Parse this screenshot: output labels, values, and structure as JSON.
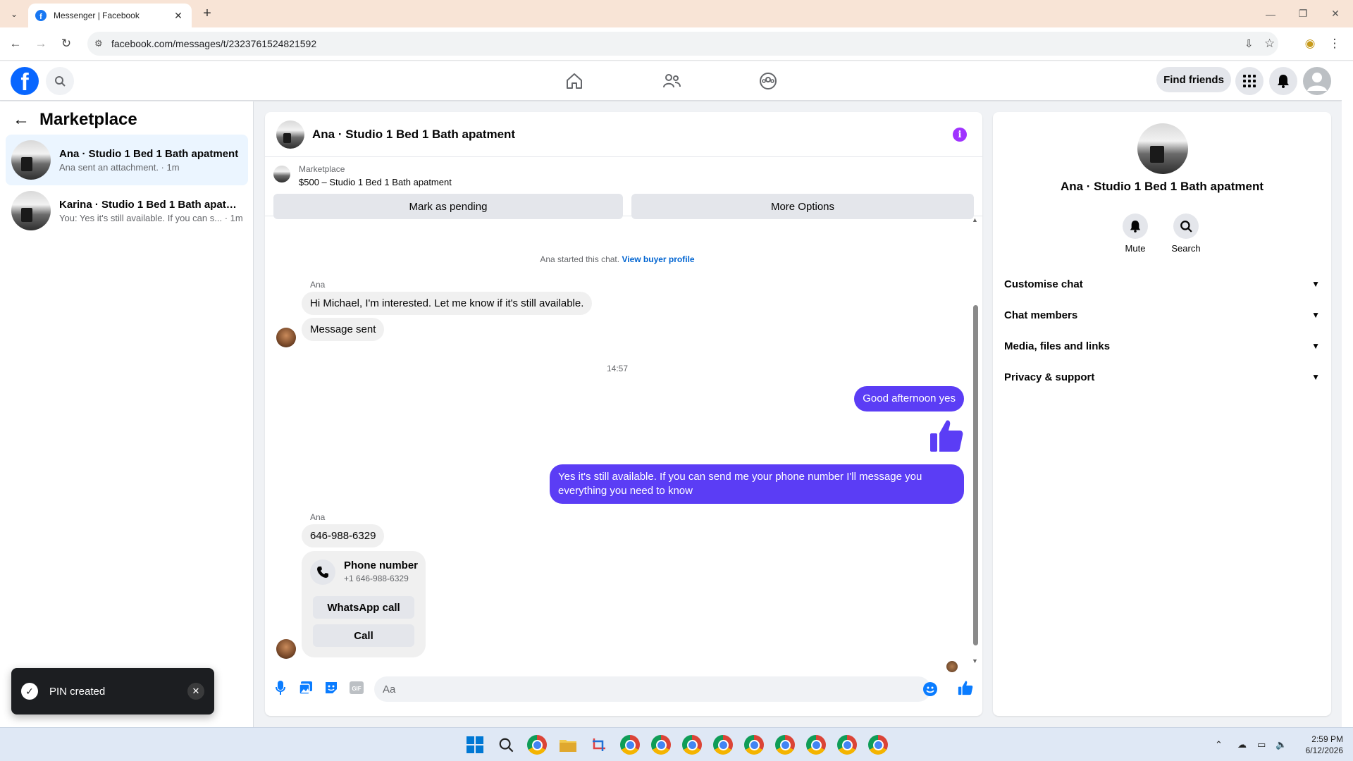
{
  "browser": {
    "tab_title": "Messenger | Facebook",
    "url": "facebook.com/messages/t/2323761524821592"
  },
  "header": {
    "find_friends_label": "Find friends"
  },
  "sidebar": {
    "title": "Marketplace",
    "conversations": [
      {
        "name": "Ana · Studio 1 Bed 1 Bath apatment",
        "preview": "Ana sent an attachment. · 1m",
        "active": true
      },
      {
        "name": "Karina · Studio 1 Bed 1 Bath apatm...",
        "preview": "You: Yes it's still available. If you can s... · 1m",
        "active": false
      }
    ]
  },
  "toast": {
    "message": "PIN created"
  },
  "chat": {
    "title": "Ana · Studio 1 Bed 1 Bath apatment",
    "listing": {
      "label": "Marketplace",
      "price_title": "$500 – Studio 1 Bed 1 Bath apatment",
      "mark_pending_label": "Mark as pending",
      "more_options_label": "More Options"
    },
    "system_text": "Ana started this chat.",
    "system_link": "View buyer profile",
    "sender_name": "Ana",
    "msg1": "Hi Michael, I'm interested. Let me know if it's still available.",
    "msg2": "Message sent",
    "timestamp": "14:57",
    "out1": "Good afternoon yes",
    "out2": "Yes it's still available. If you can send me your phone number I'll message you everything you need to know",
    "sender_name_2": "Ana",
    "msg3": "646-988-6329",
    "phone_card": {
      "title": "Phone number",
      "number": "+1 646-988-6329",
      "whatsapp_label": "WhatsApp call",
      "call_label": "Call"
    },
    "composer_placeholder": "Aa"
  },
  "right_panel": {
    "name": "Ana · Studio 1 Bed 1 Bath apatment",
    "mute_label": "Mute",
    "search_label": "Search",
    "rows": [
      "Customise chat",
      "Chat members",
      "Media, files and links",
      "Privacy & support"
    ]
  },
  "taskbar": {
    "time": "2:59 PM",
    "date": "6/12/2026"
  },
  "colors": {
    "brand_blue": "#0866ff",
    "outgoing_bubble": "#5b3df5",
    "info_purple": "#a033ff"
  }
}
